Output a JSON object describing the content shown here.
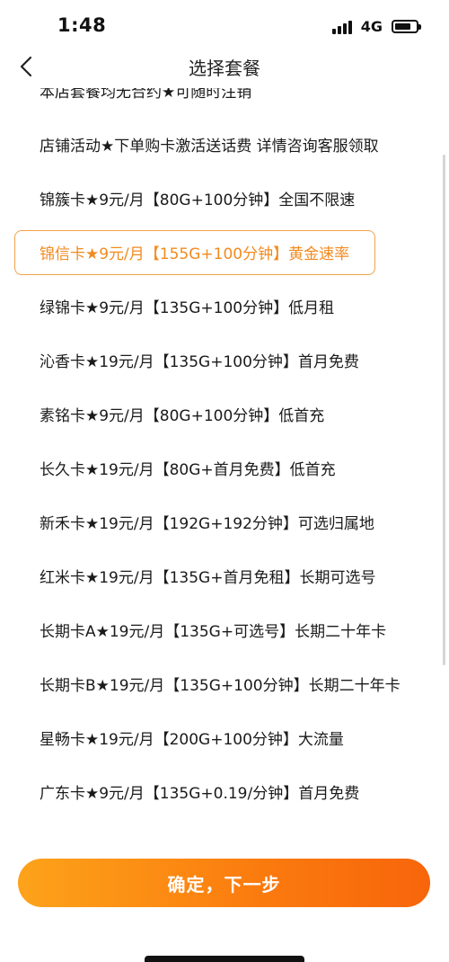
{
  "status_bar": {
    "time": "1:48",
    "network": "4G",
    "battery_level": 0.75
  },
  "header": {
    "back_icon": "chevron-left-icon",
    "title": "选择套餐"
  },
  "plans": [
    {
      "label": "本店套餐均无合约★可随时注销"
    },
    {
      "label": "店铺活动★下单购卡激活送话费 详情咨询客服领取"
    },
    {
      "label": "锦簇卡★9元/月【80G+100分钟】全国不限速"
    },
    {
      "label": "锦信卡★9元/月【155G+100分钟】黄金速率"
    },
    {
      "label": "绿锦卡★9元/月【135G+100分钟】低月租"
    },
    {
      "label": "沁香卡★19元/月【135G+100分钟】首月免费"
    },
    {
      "label": "素铭卡★9元/月【80G+100分钟】低首充"
    },
    {
      "label": "长久卡★19元/月【80G+首月免费】低首充"
    },
    {
      "label": "新禾卡★19元/月【192G+192分钟】可选归属地"
    },
    {
      "label": "红米卡★19元/月【135G+首月免租】长期可选号"
    },
    {
      "label": "长期卡A★19元/月【135G+可选号】长期二十年卡"
    },
    {
      "label": "长期卡B★19元/月【135G+100分钟】长期二十年卡"
    },
    {
      "label": "星畅卡★19元/月【200G+100分钟】大流量"
    },
    {
      "label": "广东卡★9元/月【135G+0.19/分钟】首月免费"
    }
  ],
  "selected_index": 3,
  "footer": {
    "confirm_label": "确定，下一步"
  },
  "colors": {
    "accent": "#f28a1f",
    "button_gradient_start": "#fda31a",
    "button_gradient_end": "#f7650b",
    "text": "#1a1a1a"
  }
}
